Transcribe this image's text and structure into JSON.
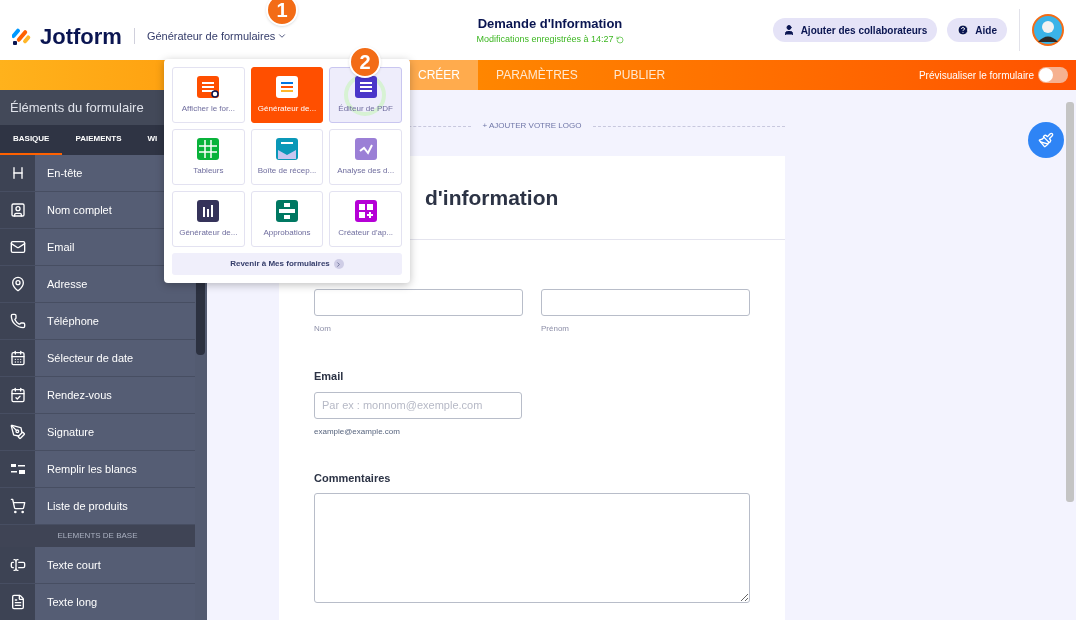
{
  "header": {
    "brand": "Jotform",
    "app_switcher": "Générateur de formulaires",
    "form_title": "Demande d'Information",
    "save_status": "Modifications enregistrées à 14:27",
    "buttons": [
      {
        "label": "Ajouter des collaborateurs",
        "kind": "user"
      },
      {
        "label": "Aide",
        "kind": "help"
      }
    ]
  },
  "nav": {
    "tabs": [
      {
        "label": "CRÉER",
        "selected": true
      },
      {
        "label": "PARAMÈTRES",
        "selected": false
      },
      {
        "label": "PUBLIER",
        "selected": false
      }
    ],
    "preview": {
      "label": "Prévisualiser le formulaire",
      "on": false
    }
  },
  "sidebar": {
    "title": "Éléments du formulaire",
    "tabs": [
      {
        "label": "BASIQUE",
        "selected": true
      },
      {
        "label": "PAIEMENTS",
        "selected": false
      },
      {
        "label": "WI",
        "selected": false
      }
    ],
    "sections": [
      {
        "items": [
          "En-tête",
          "Nom complet",
          "Email",
          "Adresse",
          "Téléphone",
          "Sélecteur de date",
          "Rendez-vous",
          "Signature",
          "Remplir les blancs",
          "Liste de produits"
        ]
      },
      {
        "heading": "ELEMENTS DE BASE",
        "items": [
          "Texte court",
          "Texte long"
        ]
      }
    ]
  },
  "app_menu": {
    "tiles": [
      {
        "label": "Afficher le for...",
        "selected": false,
        "highlighted": false
      },
      {
        "label": "Générateur de...",
        "selected": true,
        "highlighted": false
      },
      {
        "label": "Éditeur de PDF",
        "selected": false,
        "highlighted": true
      },
      {
        "label": "Tableurs",
        "selected": false,
        "highlighted": false
      },
      {
        "label": "Boîte de récep...",
        "selected": false,
        "highlighted": false
      },
      {
        "label": "Analyse des d...",
        "selected": false,
        "highlighted": false
      },
      {
        "label": "Générateur de...",
        "selected": false,
        "highlighted": false
      },
      {
        "label": "Approbations",
        "selected": false,
        "highlighted": false
      },
      {
        "label": "Créateur d'ap...",
        "selected": false,
        "highlighted": false
      }
    ],
    "back_link": "Revenir à Mes formulaires"
  },
  "callouts": [
    "1",
    "2"
  ],
  "form": {
    "add_logo": "+ AJOUTER VOTRE LOGO",
    "title": "d'information",
    "name_fields": [
      {
        "sublabel": "Nom"
      },
      {
        "sublabel": "Prénom"
      }
    ],
    "email": {
      "label": "Email",
      "placeholder": "Par ex : monnom@exemple.com",
      "sublabel": "example@example.com"
    },
    "comments": {
      "label": "Commentaires"
    }
  }
}
